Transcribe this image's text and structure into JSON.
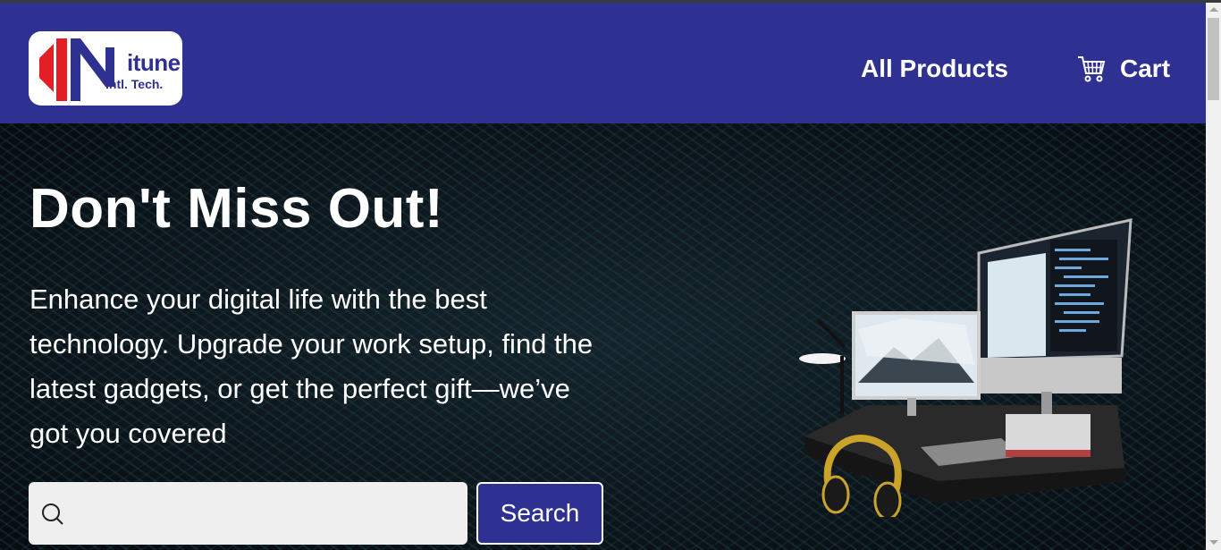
{
  "header": {
    "logo": {
      "name": "itune",
      "subtitle": "Intl. Tech."
    },
    "nav": {
      "products_label": "All Products",
      "cart_label": "Cart"
    }
  },
  "hero": {
    "title": "Don't Miss Out!",
    "text": "Enhance your digital life with the best technology. Upgrade your work setup, find the latest gadgets, or get the perfect gift—we’ve got you covered",
    "search": {
      "value": "",
      "placeholder": "",
      "button_label": "Search"
    }
  },
  "icons": {
    "cart": "cart-icon",
    "search": "search-icon"
  },
  "colors": {
    "brand": "#2e3192",
    "logo_red": "#e31e24",
    "hero_bg": "#0e171d"
  }
}
